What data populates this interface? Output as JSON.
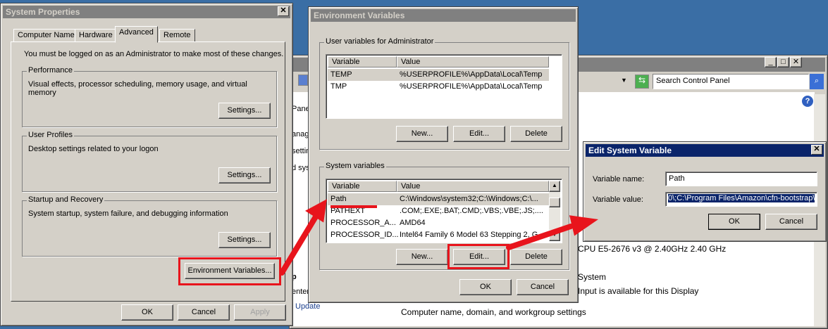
{
  "control_panel": {
    "search_placeholder": "Search Control Panel",
    "left_fragments": [
      "Panel",
      "anag",
      "settin",
      "d sys",
      "p",
      "enter",
      "Update"
    ],
    "cpu_text": "CPU E5-2676 v3 @ 2.40GHz   2.40 GHz",
    "system_text": "System",
    "input_text": "Input is available for this Display",
    "section": "Computer name, domain, and workgroup settings",
    "window_buttons": [
      "_",
      "□",
      "✕"
    ]
  },
  "system_properties": {
    "title": "System Properties",
    "tabs": [
      "Computer Name",
      "Hardware",
      "Advanced",
      "Remote"
    ],
    "active_tab": "Advanced",
    "notice": "You must be logged on as an Administrator to make most of these changes.",
    "groups": [
      {
        "label": "Performance",
        "desc": "Visual effects, processor scheduling, memory usage, and virtual memory",
        "button": "Settings..."
      },
      {
        "label": "User Profiles",
        "desc": "Desktop settings related to your logon",
        "button": "Settings..."
      },
      {
        "label": "Startup and Recovery",
        "desc": "System startup, system failure, and debugging information",
        "button": "Settings..."
      }
    ],
    "env_button": "Environment Variables...",
    "ok": "OK",
    "cancel": "Cancel",
    "apply": "Apply"
  },
  "env_vars": {
    "title": "Environment Variables",
    "user_group": "User variables for Administrator",
    "system_group": "System variables",
    "col_variable": "Variable",
    "col_value": "Value",
    "user_rows": [
      {
        "variable": "TEMP",
        "value": "%USERPROFILE%\\AppData\\Local\\Temp"
      },
      {
        "variable": "TMP",
        "value": "%USERPROFILE%\\AppData\\Local\\Temp"
      }
    ],
    "system_rows": [
      {
        "variable": "Path",
        "value": "C:\\Windows\\system32;C:\\Windows;C:\\..."
      },
      {
        "variable": "PATHEXT",
        "value": ".COM;.EXE;.BAT;.CMD;.VBS;.VBE;.JS;...."
      },
      {
        "variable": "PROCESSOR_A...",
        "value": "AMD64"
      },
      {
        "variable": "PROCESSOR_ID...",
        "value": "Intel64 Family 6 Model 63 Stepping 2, G..."
      }
    ],
    "new": "New...",
    "edit": "Edit...",
    "delete": "Delete",
    "ok": "OK",
    "cancel": "Cancel"
  },
  "edit_var": {
    "title": "Edit System Variable",
    "name_label": "Variable name:",
    "name_value": "Path",
    "value_label": "Variable value:",
    "value_value": "0\\;C:\\Program Files\\Amazon\\cfn-bootstrap\\",
    "ok": "OK",
    "cancel": "Cancel"
  },
  "annotation_color": "#e8141c"
}
